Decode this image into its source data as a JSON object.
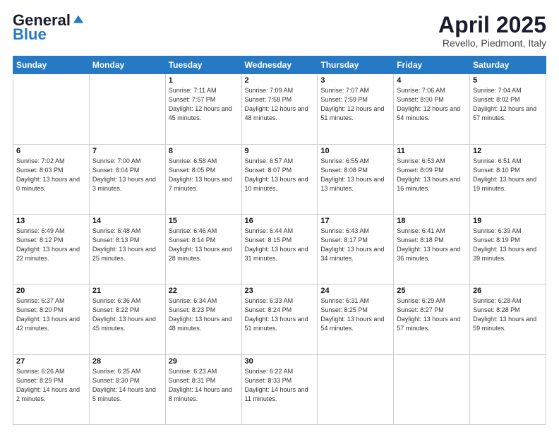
{
  "header": {
    "logo_general": "General",
    "logo_blue": "Blue",
    "title": "April 2025",
    "subtitle": "Revello, Piedmont, Italy"
  },
  "days_of_week": [
    "Sunday",
    "Monday",
    "Tuesday",
    "Wednesday",
    "Thursday",
    "Friday",
    "Saturday"
  ],
  "weeks": [
    [
      {
        "day": "",
        "sunrise": "",
        "sunset": "",
        "daylight": ""
      },
      {
        "day": "",
        "sunrise": "",
        "sunset": "",
        "daylight": ""
      },
      {
        "day": "1",
        "sunrise": "Sunrise: 7:11 AM",
        "sunset": "Sunset: 7:57 PM",
        "daylight": "Daylight: 12 hours and 45 minutes."
      },
      {
        "day": "2",
        "sunrise": "Sunrise: 7:09 AM",
        "sunset": "Sunset: 7:58 PM",
        "daylight": "Daylight: 12 hours and 48 minutes."
      },
      {
        "day": "3",
        "sunrise": "Sunrise: 7:07 AM",
        "sunset": "Sunset: 7:59 PM",
        "daylight": "Daylight: 12 hours and 51 minutes."
      },
      {
        "day": "4",
        "sunrise": "Sunrise: 7:06 AM",
        "sunset": "Sunset: 8:00 PM",
        "daylight": "Daylight: 12 hours and 54 minutes."
      },
      {
        "day": "5",
        "sunrise": "Sunrise: 7:04 AM",
        "sunset": "Sunset: 8:02 PM",
        "daylight": "Daylight: 12 hours and 57 minutes."
      }
    ],
    [
      {
        "day": "6",
        "sunrise": "Sunrise: 7:02 AM",
        "sunset": "Sunset: 8:03 PM",
        "daylight": "Daylight: 13 hours and 0 minutes."
      },
      {
        "day": "7",
        "sunrise": "Sunrise: 7:00 AM",
        "sunset": "Sunset: 8:04 PM",
        "daylight": "Daylight: 13 hours and 3 minutes."
      },
      {
        "day": "8",
        "sunrise": "Sunrise: 6:58 AM",
        "sunset": "Sunset: 8:05 PM",
        "daylight": "Daylight: 13 hours and 7 minutes."
      },
      {
        "day": "9",
        "sunrise": "Sunrise: 6:57 AM",
        "sunset": "Sunset: 8:07 PM",
        "daylight": "Daylight: 13 hours and 10 minutes."
      },
      {
        "day": "10",
        "sunrise": "Sunrise: 6:55 AM",
        "sunset": "Sunset: 8:08 PM",
        "daylight": "Daylight: 13 hours and 13 minutes."
      },
      {
        "day": "11",
        "sunrise": "Sunrise: 6:53 AM",
        "sunset": "Sunset: 8:09 PM",
        "daylight": "Daylight: 13 hours and 16 minutes."
      },
      {
        "day": "12",
        "sunrise": "Sunrise: 6:51 AM",
        "sunset": "Sunset: 8:10 PM",
        "daylight": "Daylight: 13 hours and 19 minutes."
      }
    ],
    [
      {
        "day": "13",
        "sunrise": "Sunrise: 6:49 AM",
        "sunset": "Sunset: 8:12 PM",
        "daylight": "Daylight: 13 hours and 22 minutes."
      },
      {
        "day": "14",
        "sunrise": "Sunrise: 6:48 AM",
        "sunset": "Sunset: 8:13 PM",
        "daylight": "Daylight: 13 hours and 25 minutes."
      },
      {
        "day": "15",
        "sunrise": "Sunrise: 6:46 AM",
        "sunset": "Sunset: 8:14 PM",
        "daylight": "Daylight: 13 hours and 28 minutes."
      },
      {
        "day": "16",
        "sunrise": "Sunrise: 6:44 AM",
        "sunset": "Sunset: 8:15 PM",
        "daylight": "Daylight: 13 hours and 31 minutes."
      },
      {
        "day": "17",
        "sunrise": "Sunrise: 6:43 AM",
        "sunset": "Sunset: 8:17 PM",
        "daylight": "Daylight: 13 hours and 34 minutes."
      },
      {
        "day": "18",
        "sunrise": "Sunrise: 6:41 AM",
        "sunset": "Sunset: 8:18 PM",
        "daylight": "Daylight: 13 hours and 36 minutes."
      },
      {
        "day": "19",
        "sunrise": "Sunrise: 6:39 AM",
        "sunset": "Sunset: 8:19 PM",
        "daylight": "Daylight: 13 hours and 39 minutes."
      }
    ],
    [
      {
        "day": "20",
        "sunrise": "Sunrise: 6:37 AM",
        "sunset": "Sunset: 8:20 PM",
        "daylight": "Daylight: 13 hours and 42 minutes."
      },
      {
        "day": "21",
        "sunrise": "Sunrise: 6:36 AM",
        "sunset": "Sunset: 8:22 PM",
        "daylight": "Daylight: 13 hours and 45 minutes."
      },
      {
        "day": "22",
        "sunrise": "Sunrise: 6:34 AM",
        "sunset": "Sunset: 8:23 PM",
        "daylight": "Daylight: 13 hours and 48 minutes."
      },
      {
        "day": "23",
        "sunrise": "Sunrise: 6:33 AM",
        "sunset": "Sunset: 8:24 PM",
        "daylight": "Daylight: 13 hours and 51 minutes."
      },
      {
        "day": "24",
        "sunrise": "Sunrise: 6:31 AM",
        "sunset": "Sunset: 8:25 PM",
        "daylight": "Daylight: 13 hours and 54 minutes."
      },
      {
        "day": "25",
        "sunrise": "Sunrise: 6:29 AM",
        "sunset": "Sunset: 8:27 PM",
        "daylight": "Daylight: 13 hours and 57 minutes."
      },
      {
        "day": "26",
        "sunrise": "Sunrise: 6:28 AM",
        "sunset": "Sunset: 8:28 PM",
        "daylight": "Daylight: 13 hours and 59 minutes."
      }
    ],
    [
      {
        "day": "27",
        "sunrise": "Sunrise: 6:26 AM",
        "sunset": "Sunset: 8:29 PM",
        "daylight": "Daylight: 14 hours and 2 minutes."
      },
      {
        "day": "28",
        "sunrise": "Sunrise: 6:25 AM",
        "sunset": "Sunset: 8:30 PM",
        "daylight": "Daylight: 14 hours and 5 minutes."
      },
      {
        "day": "29",
        "sunrise": "Sunrise: 6:23 AM",
        "sunset": "Sunset: 8:31 PM",
        "daylight": "Daylight: 14 hours and 8 minutes."
      },
      {
        "day": "30",
        "sunrise": "Sunrise: 6:22 AM",
        "sunset": "Sunset: 8:33 PM",
        "daylight": "Daylight: 14 hours and 11 minutes."
      },
      {
        "day": "",
        "sunrise": "",
        "sunset": "",
        "daylight": ""
      },
      {
        "day": "",
        "sunrise": "",
        "sunset": "",
        "daylight": ""
      },
      {
        "day": "",
        "sunrise": "",
        "sunset": "",
        "daylight": ""
      }
    ]
  ]
}
